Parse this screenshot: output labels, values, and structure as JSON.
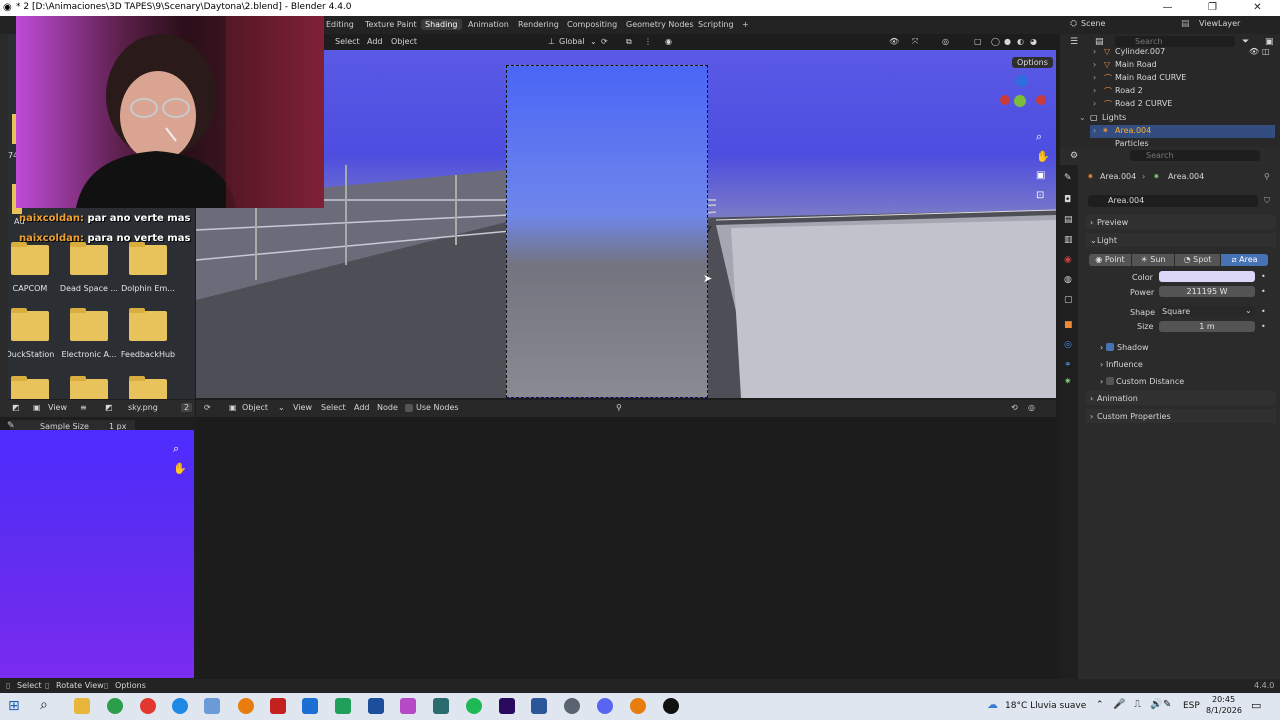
{
  "window": {
    "title": "* 2 [D:\\Animaciones\\3D TAPES\\9\\Scenary\\Daytona\\2.blend] - Blender 4.4.0",
    "minimize": "—",
    "maximize": "❐",
    "close": "✕"
  },
  "workspaces": [
    "Editing",
    "Texture Paint",
    "Shading",
    "Animation",
    "Rendering",
    "Compositing",
    "Geometry Nodes",
    "Scripting",
    "+"
  ],
  "active_workspace": "Shading",
  "top_right": {
    "scene": "Scene",
    "view_layer": "ViewLayer"
  },
  "viewport": {
    "menu": [
      "Select",
      "Add",
      "Object"
    ],
    "transform": "Global",
    "options": "Options"
  },
  "desktop": {
    "chat": [
      {
        "user": "naixcoldan:",
        "message": "par ano verte mas"
      },
      {
        "user": "naixcoldan:",
        "message": "para no verte mas"
      }
    ],
    "folders_row1": [
      "CAPCOM",
      "Dead Space ...",
      "Dolphin Em..."
    ],
    "folders_row2": [
      "DuckStation",
      "Electronic A...",
      "FeedbackHub"
    ],
    "side_labels": [
      "74",
      "Au"
    ]
  },
  "image_editor": {
    "view_menu": "View",
    "image_name": "sky.png",
    "users": "2",
    "sample_size_label": "Sample Size",
    "sample_size_value": "1 px"
  },
  "node_editor": {
    "mode": "Object",
    "menu": [
      "View",
      "Select",
      "Add",
      "Node"
    ],
    "use_nodes": "Use Nodes"
  },
  "outliner": {
    "search_placeholder": "Search",
    "rows": [
      {
        "name": "Cylinder.007",
        "selected": false
      },
      {
        "name": "Main Road",
        "selected": false
      },
      {
        "name": "Main Road CURVE",
        "selected": false
      },
      {
        "name": "Road 2",
        "selected": false
      },
      {
        "name": "Road 2 CURVE",
        "selected": false
      },
      {
        "name": "Lights",
        "selected": false
      },
      {
        "name": "Area.004",
        "selected": true
      },
      {
        "name": "Particles",
        "selected": false
      }
    ]
  },
  "properties": {
    "search_placeholder": "Search",
    "breadcrumb_obj": "Area.004",
    "breadcrumb_data": "Area.004",
    "datablock": "Area.004",
    "panels": {
      "preview": "Preview",
      "light": "Light",
      "animation": "Animation",
      "custom_properties": "Custom Properties"
    },
    "light_types": [
      "Point",
      "Sun",
      "Spot",
      "Area"
    ],
    "active_light_type": "Area",
    "color_label": "Color",
    "color_value": "#dcd6f7",
    "power_label": "Power",
    "power_value": "211195 W",
    "shape_label": "Shape",
    "shape_value": "Square",
    "size_label": "Size",
    "size_value": "1 m",
    "subpanels": [
      "Shadow",
      "Influence",
      "Custom Distance"
    ]
  },
  "statusbar": {
    "items": [
      "Select",
      "Rotate View",
      "Options"
    ],
    "version": "4.4.0"
  },
  "taskbar": {
    "weather": "18°C  Lluvia suave",
    "lang": "ESP",
    "time": "20:45",
    "date": "8/1/2026"
  }
}
